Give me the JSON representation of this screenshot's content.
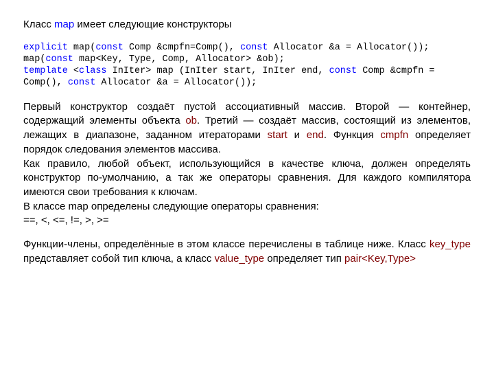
{
  "intro": {
    "pre": "Класс ",
    "kw": "map",
    "post": " имеет следующие конструкторы"
  },
  "code": {
    "l1": {
      "a": "explicit",
      "b": " map(",
      "c": "const",
      "d": " Comp &cmpfn=Comp(), ",
      "e": "const",
      "f": " Allocator &a = Allocator());"
    },
    "l2": {
      "a": "map(",
      "b": "const",
      "c": " map<Key, Type, Comp, Allocator> &ob);"
    },
    "l3": {
      "a": "template",
      "b": " <",
      "c": "class",
      "d": " InIter> map (InIter start, InIter end, ",
      "e": "const",
      "f": " Comp &cmpfn = Comp(), ",
      "g": "const",
      "h": " Allocator &a = Allocator());"
    }
  },
  "body1": {
    "a": "Первый конструктор создаёт пустой ассоциативный массив. Второй — контейнер, содержащий элементы объекта ",
    "ob": "ob",
    "b": ". Третий — создаёт массив, состоящий из элементов, лежащих в диапазоне, заданном итераторами ",
    "start": "start",
    "c": " и ",
    "end": "end",
    "d": ". Функция ",
    "cmpfn": "cmpfn",
    "e": " определяет порядок следования элементов массива."
  },
  "body2": "Как правило, любой объект, использующийся в качестве ключа, должен определять конструктор по-умолчанию, а так же операторы сравнения. Для каждого компилятора имеются свои требования к ключам.",
  "body3": "В классе map определены следующие операторы сравнения:",
  "ops": "==, <, <=, !=, >, >=",
  "body4": {
    "a": "Функции-члены, определённые в этом классе перечислены в таблице ниже. Класс ",
    "kt": "key_type",
    "b": " представляет собой тип ключа, а класс ",
    "vt": "value_type",
    "c": " определяет тип ",
    "pair": "pair<Key,Type>"
  }
}
